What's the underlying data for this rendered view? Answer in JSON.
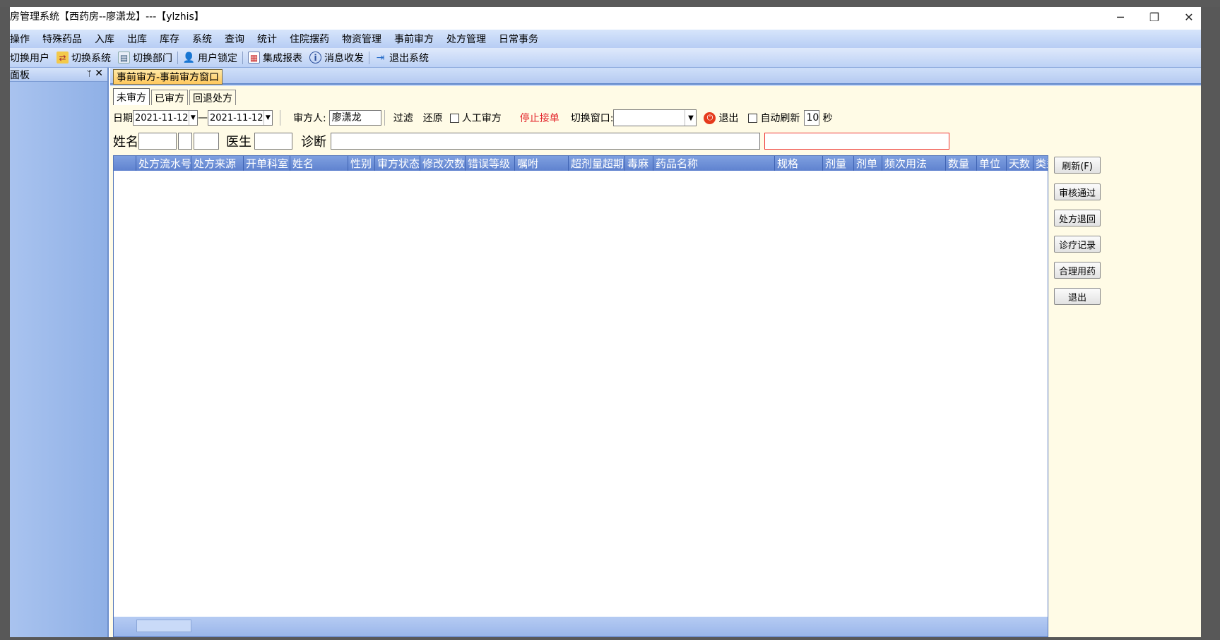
{
  "window": {
    "title": "房管理系统【西药房--廖潇龙】---【ylzhis】",
    "minimize_icon": "minimize-icon",
    "restore_icon": "restore-icon",
    "close_icon": "close-icon"
  },
  "menu": [
    "操作",
    "特殊药品",
    "入库",
    "出库",
    "库存",
    "系统",
    "查询",
    "统计",
    "住院摆药",
    "物资管理",
    "事前审方",
    "处方管理",
    "日常事务"
  ],
  "toolbar": [
    {
      "label": "切换用户",
      "icon": "none"
    },
    {
      "label": "切换系统",
      "icon": "switch-system-icon"
    },
    {
      "label": "切换部门",
      "icon": "switch-dept-icon"
    },
    {
      "label": "用户锁定",
      "icon": "user-lock-icon"
    },
    {
      "label": "集成报表",
      "icon": "report-icon"
    },
    {
      "label": "消息收发",
      "icon": "info-icon"
    },
    {
      "label": "退出系统",
      "icon": "exit-icon"
    }
  ],
  "panel": {
    "title": "面板",
    "pin": "ᛘ",
    "close": "✕"
  },
  "doc_tab": "事前审方-事前审方窗口",
  "sub_tabs": [
    {
      "label": "未审方",
      "active": true
    },
    {
      "label": "已审方",
      "active": false
    },
    {
      "label": "回退处方",
      "active": false
    }
  ],
  "filter": {
    "date_label": "日期",
    "date_from": "2021-11-12",
    "date_sep": "—",
    "date_to": "2021-11-12",
    "reviewer_label": "审方人:",
    "reviewer_value": "廖潇龙",
    "filter_btn": "过滤",
    "restore_btn": "还原",
    "manual_review_label": "人工审方",
    "stop_order": "停止接单",
    "switch_window_label": "切换窗口:",
    "switch_window_value": "",
    "exit_label": "退出",
    "auto_refresh_label": "自动刷新",
    "auto_refresh_seconds": "10",
    "seconds_unit": "秒"
  },
  "search": {
    "name_label": "姓名",
    "doctor_label": "医生",
    "diagnosis_label": "诊断"
  },
  "grid": {
    "columns": [
      "",
      "处方流水号",
      "处方来源",
      "开单科室",
      "姓名",
      "性别",
      "审方状态",
      "修改次数",
      "错误等级",
      "嘱咐",
      "超剂量超期",
      "毒麻",
      "药品名称",
      "规格",
      "剂量",
      "剂单",
      "频次用法",
      "数量",
      "单位",
      "天数",
      "类型"
    ],
    "rows": []
  },
  "side_buttons": [
    "刷新(F)",
    "审核通过",
    "处方退回",
    "诊疗记录",
    "合理用药",
    "退出"
  ],
  "colors": {
    "menubar": "#c3d6f7",
    "grid_header": "#6f92d8",
    "doc_tab": "#ffd27a",
    "content_bg": "#fffbe6",
    "stop_order": "#e3242b"
  }
}
